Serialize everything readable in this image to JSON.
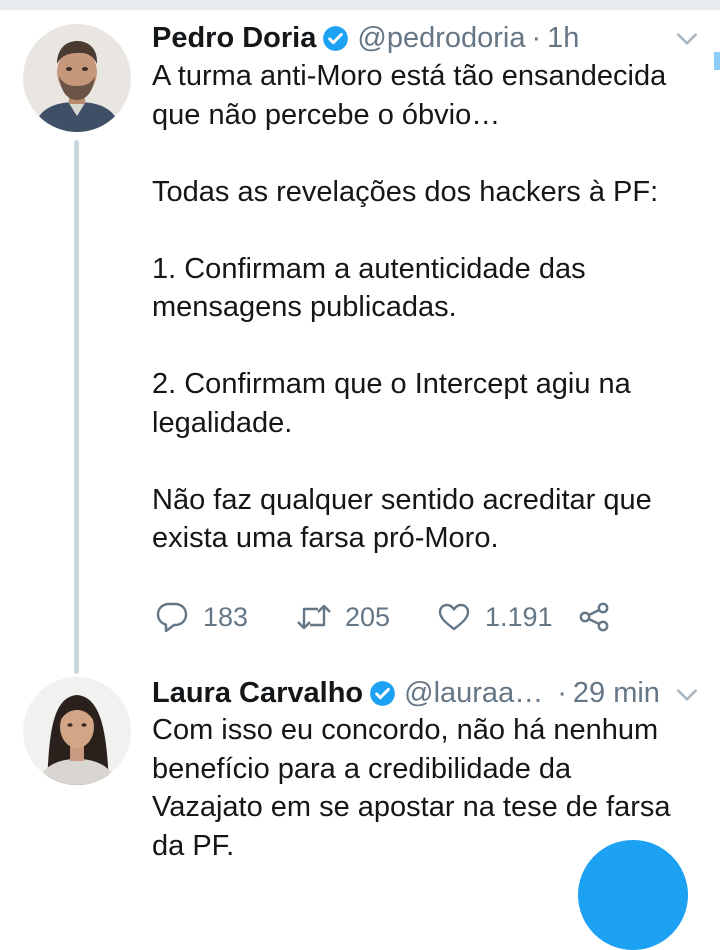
{
  "tweets": [
    {
      "name": "Pedro Doria",
      "handle": "@pedrodoria",
      "separator": "·",
      "time": "1h",
      "text": "A turma anti-Moro está tão ensandecida\nque não percebe o óbvio…\n\nTodas as revelações dos hackers à PF:\n\n1. Confirmam a autenticidade das\nmensagens publicadas.\n\n2. Confirmam que o Intercept agiu na\nlegalidade.\n\nNão faz qualquer sentido acreditar que\nexista uma farsa pró-Moro.",
      "replies": "183",
      "retweets": "205",
      "likes": "1.191"
    },
    {
      "name": "Laura Carvalho",
      "handle": "@lauraa…",
      "separator": "·",
      "time": "29 min",
      "text": "Com isso eu concordo, não há nenhum\nbenefício para a credibilidade da\nVazajato em se apostar na tese de farsa\nda PF."
    }
  ],
  "colors": {
    "accent": "#1da1f2",
    "secondary_text": "#657786",
    "thread_line": "#ccd6dd"
  },
  "icons": [
    "verified-badge-icon",
    "chevron-down-icon",
    "reply-icon",
    "retweet-icon",
    "like-icon",
    "share-icon"
  ]
}
